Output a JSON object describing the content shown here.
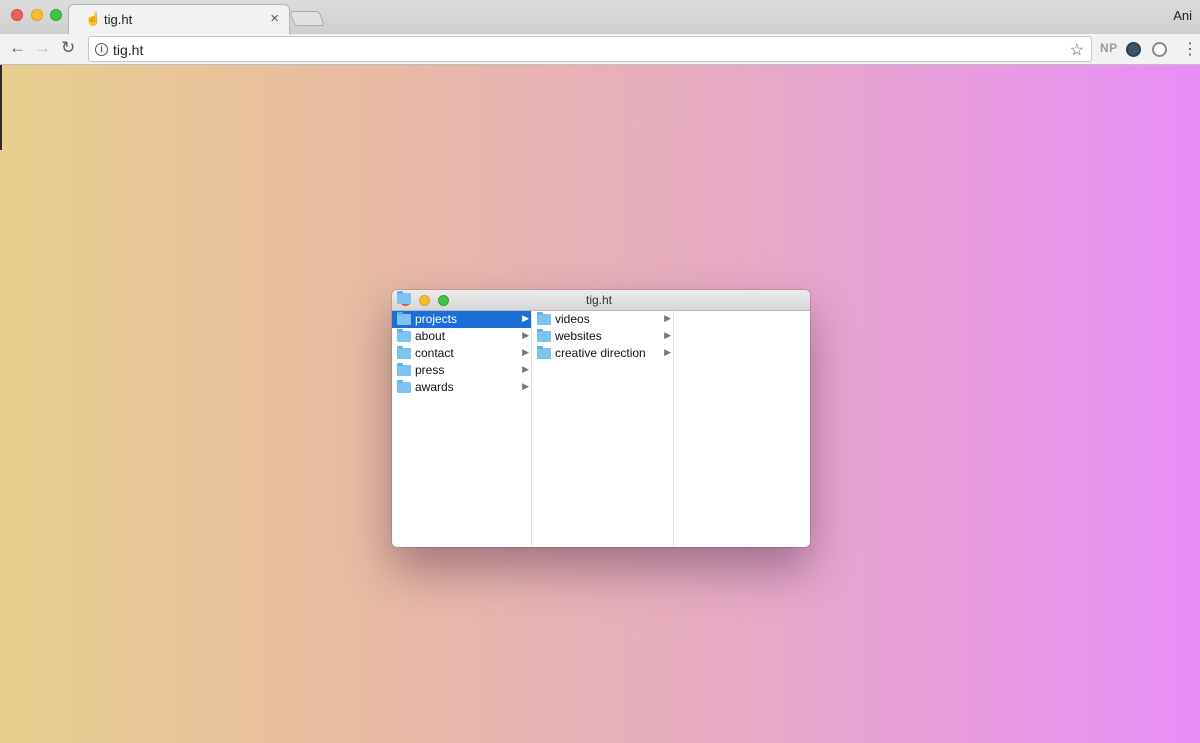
{
  "browser": {
    "tab": {
      "title": "tig.ht",
      "favicon": "hand-pointer-icon",
      "close_label": "×"
    },
    "profile_name": "Ani",
    "omnibox": {
      "url": "tig.ht",
      "info_label": "i"
    },
    "toolbar": {
      "back": "←",
      "forward": "→",
      "reload": "↻",
      "star": "☆",
      "menu": "⋮"
    },
    "extensions": {
      "np_label": "NP"
    }
  },
  "page": {
    "gradient_colors": [
      "#e8cf8e",
      "#e8b9a5",
      "#e7aac6",
      "#e88ef8"
    ]
  },
  "finder": {
    "title": "tig.ht",
    "selection_color": "#1a6fd6",
    "columns": [
      {
        "items": [
          {
            "label": "projects",
            "arrow": "▶",
            "selected": true
          },
          {
            "label": "about",
            "arrow": "▶"
          },
          {
            "label": "contact",
            "arrow": "▶"
          },
          {
            "label": "press",
            "arrow": "▶"
          },
          {
            "label": "awards",
            "arrow": "▶"
          }
        ]
      },
      {
        "items": [
          {
            "label": "videos",
            "arrow": "▶"
          },
          {
            "label": "websites",
            "arrow": "▶"
          },
          {
            "label": "creative direction",
            "arrow": "▶"
          }
        ]
      },
      {
        "items": []
      }
    ]
  }
}
